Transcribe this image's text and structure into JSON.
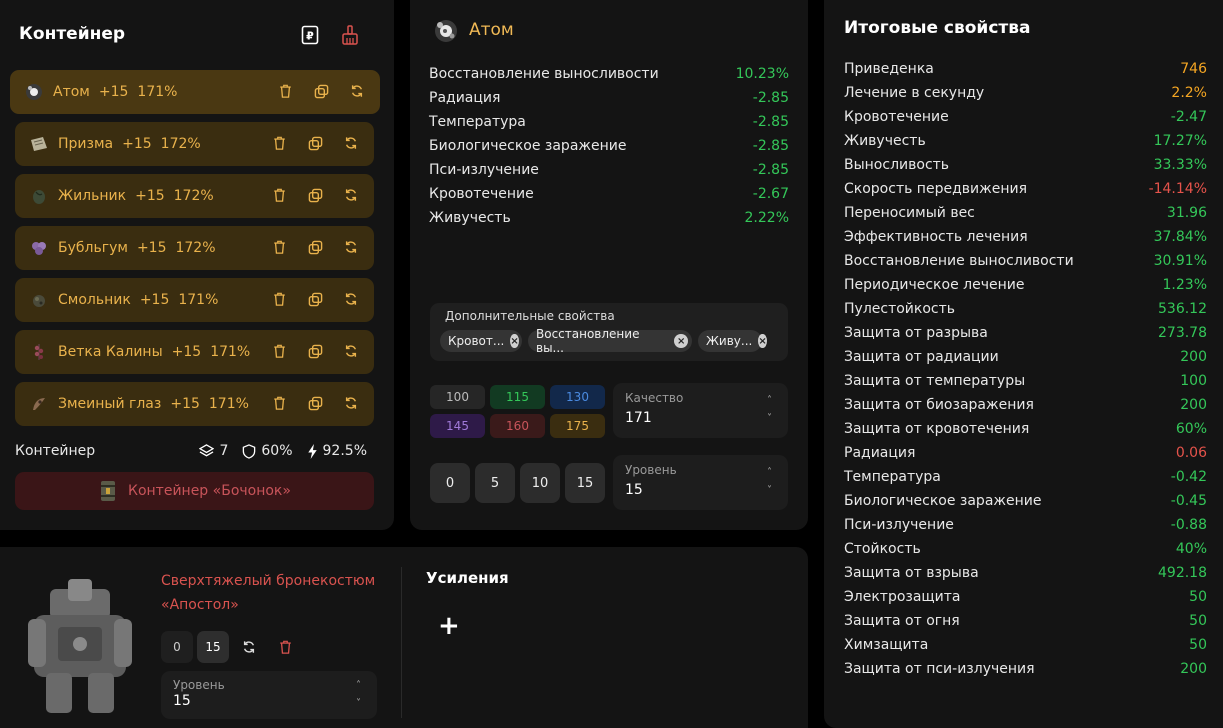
{
  "container": {
    "title": "Контейнер",
    "items": [
      {
        "name": "Атом",
        "level": "+15",
        "pct": "171%",
        "icon": "atom-artifact-icon"
      },
      {
        "name": "Призма",
        "level": "+15",
        "pct": "172%",
        "icon": "prism-artifact-icon"
      },
      {
        "name": "Жильник",
        "level": "+15",
        "pct": "172%",
        "icon": "zhilnik-artifact-icon"
      },
      {
        "name": "Бубльгум",
        "level": "+15",
        "pct": "172%",
        "icon": "bubblegum-artifact-icon"
      },
      {
        "name": "Смольник",
        "level": "+15",
        "pct": "171%",
        "icon": "smolnik-artifact-icon"
      },
      {
        "name": "Ветка Калины",
        "level": "+15",
        "pct": "171%",
        "icon": "viburnum-artifact-icon"
      },
      {
        "name": "Змеиный глаз",
        "level": "+15",
        "pct": "171%",
        "icon": "snake-eye-artifact-icon"
      }
    ],
    "footer": {
      "label": "Контейнер",
      "slots": "7",
      "protection": "60%",
      "efficiency": "92.5%"
    },
    "barrel_label": "Контейнер «Бочонок»"
  },
  "atom": {
    "title": "Атом",
    "props": [
      {
        "name": "Восстановление выносливости",
        "value": "10.23%"
      },
      {
        "name": "Радиация",
        "value": "-2.85"
      },
      {
        "name": "Температура",
        "value": "-2.85"
      },
      {
        "name": "Биологическое заражение",
        "value": "-2.85"
      },
      {
        "name": "Пси-излучение",
        "value": "-2.85"
      },
      {
        "name": "Кровотечение",
        "value": "-2.67"
      },
      {
        "name": "Живучесть",
        "value": "2.22%"
      }
    ],
    "extra_label": "Дополнительные свойства",
    "chips": [
      "Кровот...",
      "Восстановление вы...",
      "Живу..."
    ],
    "quality_presets": [
      "100",
      "115",
      "130",
      "145",
      "160",
      "175"
    ],
    "quality_label": "Качество",
    "quality_value": "171",
    "level_presets": [
      "0",
      "5",
      "10",
      "15"
    ],
    "level_label": "Уровень",
    "level_value": "15"
  },
  "totals": {
    "title": "Итоговые свойства",
    "rows": [
      {
        "name": "Приведенка",
        "value": "746",
        "color": "#f5a623"
      },
      {
        "name": "Лечение в секунду",
        "value": "2.2%",
        "color": "#f5a623"
      },
      {
        "name": "Кровотечение",
        "value": "-2.47",
        "color": "#34c759"
      },
      {
        "name": "Живучесть",
        "value": "17.27%",
        "color": "#34c759"
      },
      {
        "name": "Выносливость",
        "value": "33.33%",
        "color": "#34c759"
      },
      {
        "name": "Скорость передвижения",
        "value": "-14.14%",
        "color": "#e5534b"
      },
      {
        "name": "Переносимый вес",
        "value": "31.96",
        "color": "#34c759"
      },
      {
        "name": "Эффективность лечения",
        "value": "37.84%",
        "color": "#34c759"
      },
      {
        "name": "Восстановление выносливости",
        "value": "30.91%",
        "color": "#34c759"
      },
      {
        "name": "Периодическое лечение",
        "value": "1.23%",
        "color": "#34c759"
      },
      {
        "name": "Пулестойкость",
        "value": "536.12",
        "color": "#34c759"
      },
      {
        "name": "Защита от разрыва",
        "value": "273.78",
        "color": "#34c759"
      },
      {
        "name": "Защита от радиации",
        "value": "200",
        "color": "#34c759"
      },
      {
        "name": "Защита от температуры",
        "value": "100",
        "color": "#34c759"
      },
      {
        "name": "Защита от биозаражения",
        "value": "200",
        "color": "#34c759"
      },
      {
        "name": "Защита от кровотечения",
        "value": "60%",
        "color": "#34c759"
      },
      {
        "name": "Радиация",
        "value": "0.06",
        "color": "#e5534b"
      },
      {
        "name": "Температура",
        "value": "-0.42",
        "color": "#34c759"
      },
      {
        "name": "Биологическое заражение",
        "value": "-0.45",
        "color": "#34c759"
      },
      {
        "name": "Пси-излучение",
        "value": "-0.88",
        "color": "#34c759"
      },
      {
        "name": "Стойкость",
        "value": "40%",
        "color": "#34c759"
      },
      {
        "name": "Защита от взрыва",
        "value": "492.18",
        "color": "#34c759"
      },
      {
        "name": "Электрозащита",
        "value": "50",
        "color": "#34c759"
      },
      {
        "name": "Защита от огня",
        "value": "50",
        "color": "#34c759"
      },
      {
        "name": "Химзащита",
        "value": "50",
        "color": "#34c759"
      },
      {
        "name": "Защита от пси-излучения",
        "value": "200",
        "color": "#34c759"
      }
    ]
  },
  "armor": {
    "name_line1": "Сверхтяжелый бронекостюм",
    "name_line2": "«Апостол»",
    "btn_zero": "0",
    "btn_fifteen": "15",
    "level_label": "Уровень",
    "level_value": "15",
    "boosts_title": "Усиления",
    "add_symbol": "+"
  }
}
